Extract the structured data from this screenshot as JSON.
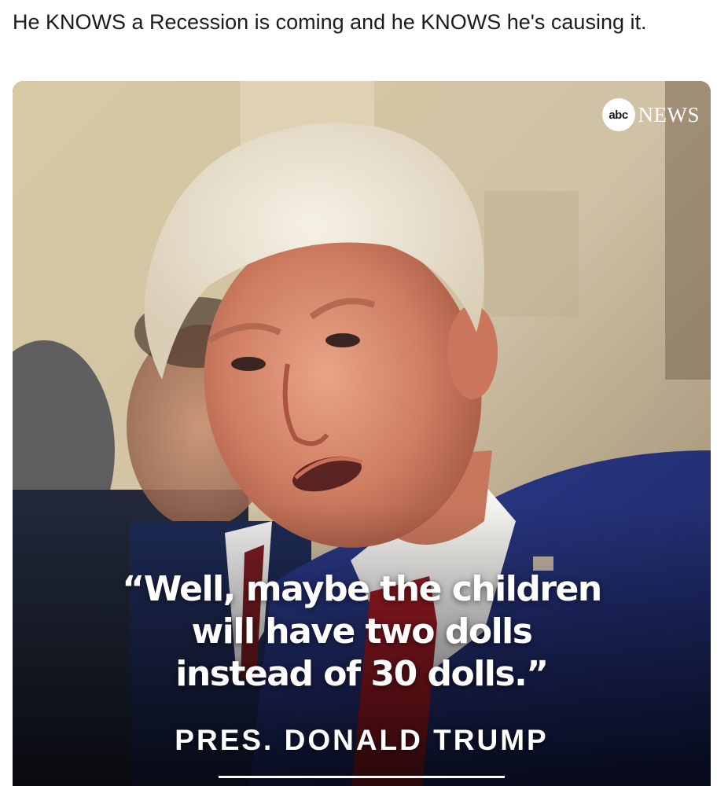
{
  "post": {
    "text": "He KNOWS a Recession is coming and he KNOWS he's causing it."
  },
  "media": {
    "network_logo": {
      "bug": "abc",
      "word": "NEWS"
    },
    "quote_lines": [
      "“Well, maybe the children",
      "will have two dolls",
      "instead of 30 dolls.”"
    ],
    "attribution": "PRES. DONALD TRUMP"
  }
}
